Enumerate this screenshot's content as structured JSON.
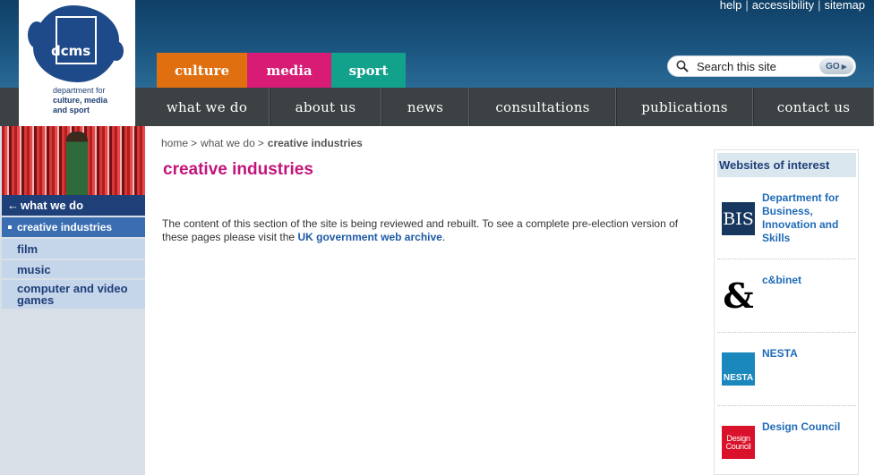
{
  "header": {
    "logo": {
      "text": "dcms",
      "caption_line1": "department for",
      "caption_line2": "culture, media",
      "caption_line3": "and sport"
    },
    "top_links": [
      "help",
      "accessibility",
      "sitemap"
    ],
    "sector_tabs": [
      {
        "label": "culture",
        "color": "#e0700f"
      },
      {
        "label": "media",
        "color": "#d81b75"
      },
      {
        "label": "sport",
        "color": "#12a28b"
      }
    ],
    "search": {
      "placeholder": "Search this site",
      "button_label": "GO"
    }
  },
  "main_nav": [
    "what we do",
    "about us",
    "news",
    "consultations",
    "publications",
    "contact us"
  ],
  "sidebar": {
    "section_title": "what we do",
    "active_item": "creative industries",
    "items": [
      "film",
      "music",
      "computer and video games"
    ]
  },
  "breadcrumb": {
    "items": [
      "home",
      "what we do"
    ],
    "current": "creative industries"
  },
  "page_title": "creative industries",
  "body": {
    "text": "The content of this section of the site is being reviewed and rebuilt. To see a complete pre-election version of these pages please visit the",
    "link_text": "UK government web archive",
    "end": "."
  },
  "right_panel": {
    "title": "Websites of interest",
    "sites": [
      {
        "name": "Department for Business, Innovation and Skills",
        "logo_text": "BIS",
        "logo_color": "#17375e"
      },
      {
        "name": "c&binet",
        "logo_text": "&",
        "logo_color": "#000000"
      },
      {
        "name": "NESTA",
        "logo_text": "NESTA",
        "logo_color": "#1a87bd"
      },
      {
        "name": "Design Council",
        "logo_text": "Design Council",
        "logo_color": "#d9112a"
      }
    ]
  }
}
